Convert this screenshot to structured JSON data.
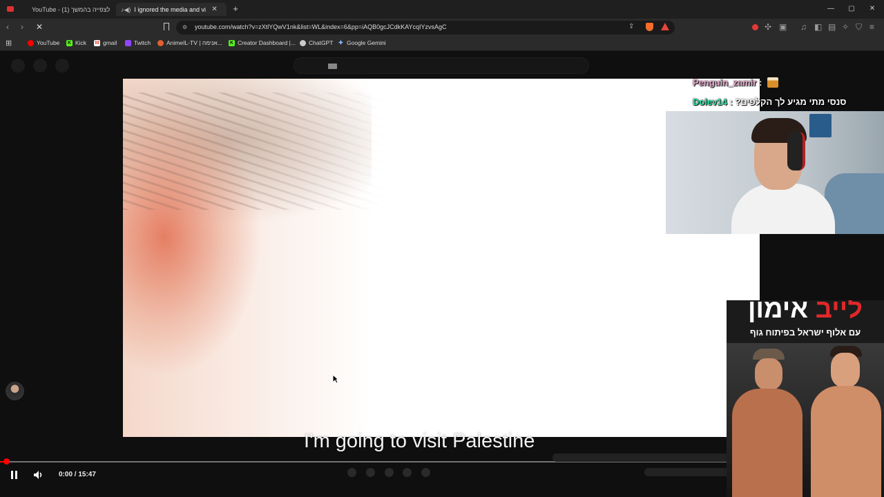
{
  "tabs": [
    {
      "title": "YouTube - לצפייה בהמשך (1)",
      "active": false
    },
    {
      "title": "I ignored the media and visit",
      "active": true
    }
  ],
  "new_tab_symbol": "+",
  "window_controls": {
    "minimize": "—",
    "maximize": "▢",
    "close": "✕"
  },
  "address_bar": {
    "url": "youtube.com/watch?v=zXtlYQwV1nk&list=WL&index=6&pp=iAQB0gcJCdkKAYcqIYzvsAgC"
  },
  "bookmarks": [
    {
      "label": "YouTube",
      "icon": "youtube-icon",
      "color": "#ff0000"
    },
    {
      "label": "Kick",
      "icon": "kick-icon",
      "color": "#53fc18"
    },
    {
      "label": "gmail",
      "icon": "gmail-icon",
      "color": "#ea4335"
    },
    {
      "label": "Twitch",
      "icon": "twitch-icon",
      "color": "#9146ff"
    },
    {
      "label": "AnimeIL-TV | אנימה...",
      "icon": "animeil-icon",
      "color": "#e06030"
    },
    {
      "label": "Creator Dashboard |...",
      "icon": "kick-icon",
      "color": "#53fc18"
    },
    {
      "label": "ChatGPT",
      "icon": "chatgpt-icon",
      "color": "#cccccc"
    },
    {
      "label": "Google Gemini",
      "icon": "gemini-icon",
      "color": "#8ab4f8"
    }
  ],
  "video": {
    "subtitle": "I'm going to visit Palestine",
    "time": "0:00 / 15:47",
    "progress_fraction": 0.003
  },
  "chat": [
    {
      "user": "Penguin_zamir",
      "separator": " : ",
      "message": "",
      "user_color": "#e3a6c8"
    },
    {
      "user": "Dolev14",
      "separator": " : ",
      "message": "סנסי מתי מגיע לך הקלפים?",
      "user_color": "#2fe0a6"
    }
  ],
  "ad": {
    "title_white": "אימון",
    "title_red": "לייב",
    "subtitle": "עם אלוף ישראל בפיתוח גוף"
  }
}
